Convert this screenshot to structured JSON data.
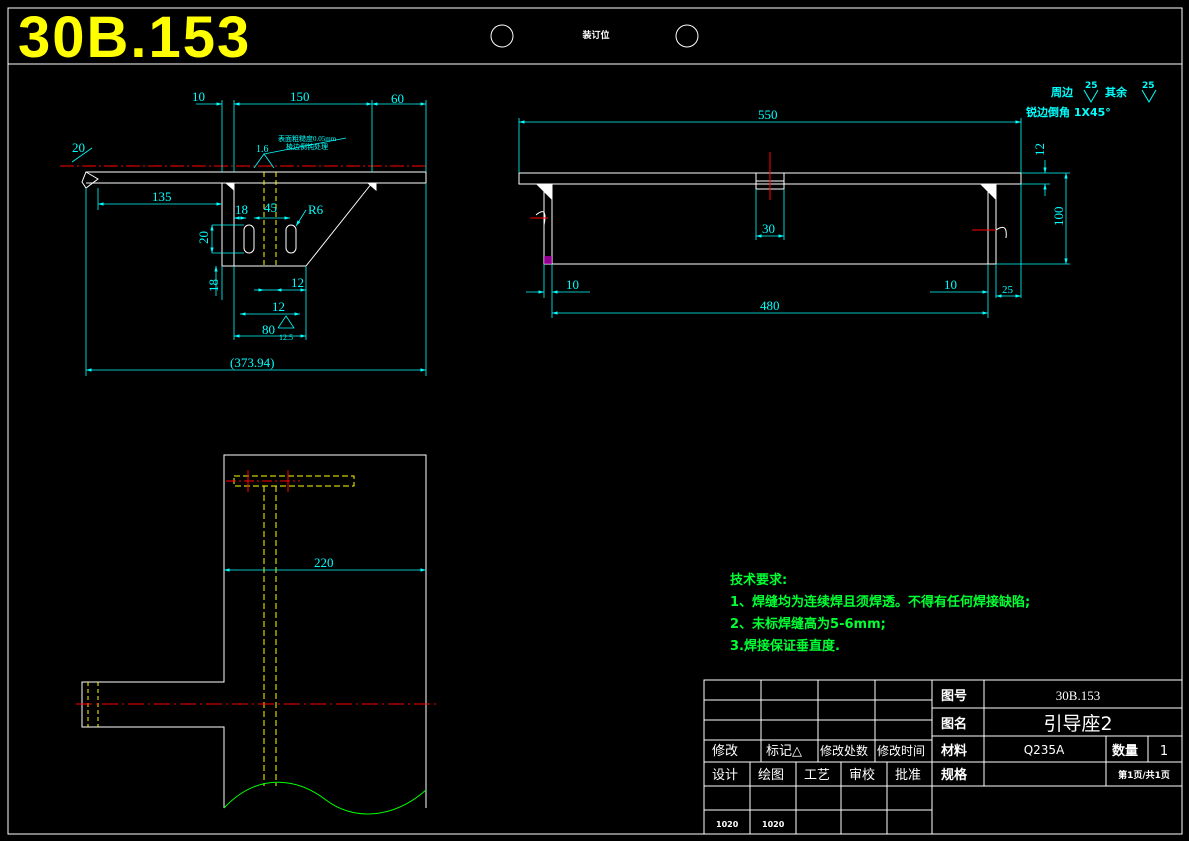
{
  "header": {
    "drawing_code": "30B.153",
    "binding_label": "装订位"
  },
  "front_view": {
    "dims": {
      "d10": "10",
      "d150": "150",
      "d60": "60",
      "d20_angle": "20",
      "d135": "135",
      "d18a": "18",
      "d45": "45",
      "r6": "R6",
      "d20_slot": "20",
      "d18b": "18",
      "d12a": "12",
      "d12b": "12",
      "d80": "80",
      "overall": "(373.94)"
    },
    "surface_symbol_a": "1.6",
    "surface_symbol_b": "12.5",
    "note_line1": "表面粗糙度0.05mm",
    "note_line2": "棱边倒钝处理"
  },
  "side_view": {
    "dims": {
      "d550": "550",
      "d12": "12",
      "d100": "100",
      "d30": "30",
      "d10a": "10",
      "d10b": "10",
      "d25": "25",
      "d480": "480"
    }
  },
  "weld_symbols": {
    "perimeter_label": "周边",
    "perimeter_value": "25",
    "others_label": "其余",
    "others_value": "25",
    "chamfer_note": "锐边倒角 1X45°"
  },
  "plan_view": {
    "dims": {
      "d220": "220"
    }
  },
  "technical_requirements": {
    "title": "技术要求:",
    "items": [
      "1、焊缝均为连续焊且须焊透。不得有任何焊接缺陷;",
      "2、未标焊缝高为5-6mm;",
      "3.焊接保证垂直度."
    ]
  },
  "title_block": {
    "drawing_no_label": "图号",
    "drawing_no_value": "30B.153",
    "drawing_name_label": "图名",
    "drawing_name_value": "引导座2",
    "material_label": "材料",
    "material_value": "Q235A",
    "quantity_label": "数量",
    "quantity_value": "1",
    "spec_label": "规格",
    "sheet_info": "第1页/共1页",
    "revision_headers": [
      "修改",
      "标记△",
      "修改处数",
      "修改时间"
    ],
    "role_headers": [
      "设计",
      "绘图",
      "工艺",
      "审校",
      "批准"
    ],
    "codes": [
      "1020",
      "1020"
    ]
  },
  "colors": {
    "background": "#000000",
    "outline": "#ffffff",
    "dimension": "#00ffff",
    "notes": "#00ff33",
    "title": "#ffff00",
    "centerline": "#ff0000",
    "hidden": "#ffff00",
    "break_line": "#00ff00"
  }
}
